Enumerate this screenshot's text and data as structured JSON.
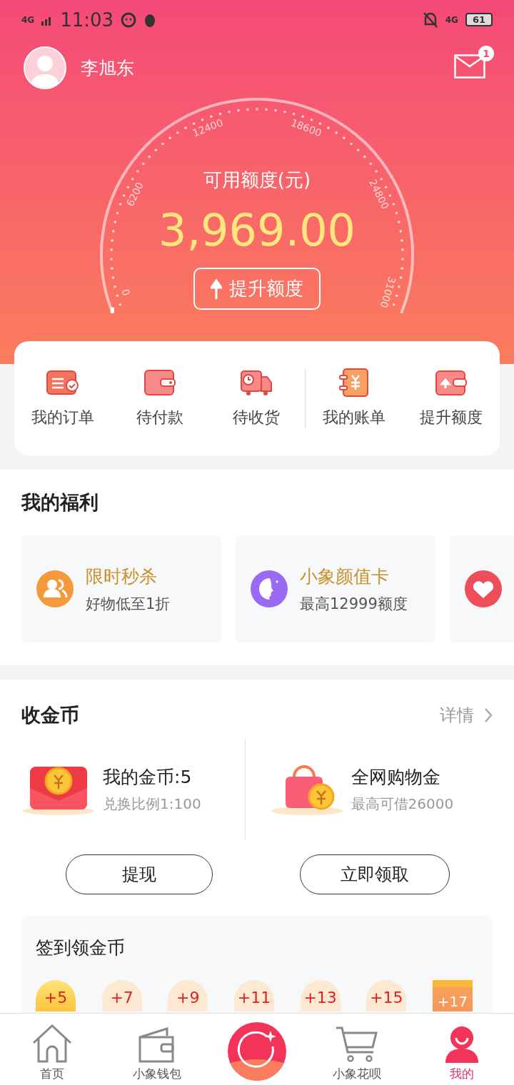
{
  "status_bar": {
    "network": "4G",
    "time": "11:03",
    "network_right": "4G",
    "battery": "61"
  },
  "header": {
    "user_name": "李旭东",
    "mail_badge": "1"
  },
  "gauge": {
    "label": "可用额度(元)",
    "amount": "3,969.00",
    "ticks": [
      "0",
      "6200",
      "12400",
      "18600",
      "24800",
      "31000"
    ],
    "button": "提升额度"
  },
  "quick_menu": {
    "groups": [
      [
        {
          "kind": "order",
          "label": "我的订单"
        },
        {
          "kind": "wallet",
          "label": "待付款"
        },
        {
          "kind": "truck",
          "label": "待收货"
        }
      ],
      [
        {
          "kind": "bill",
          "label": "我的账单"
        },
        {
          "kind": "raise",
          "label": "提升额度"
        }
      ]
    ]
  },
  "welfare": {
    "title": "我的福利",
    "cards": [
      {
        "kind": "people",
        "title": "限时秒杀",
        "subtitle": "好物低至1折"
      },
      {
        "kind": "face",
        "title": "小象颜值卡",
        "subtitle": "最高12999额度"
      },
      {
        "kind": "heart"
      }
    ]
  },
  "coins": {
    "title": "收金币",
    "link": "详情",
    "columns": [
      {
        "kind": "envelope",
        "title": "我的金币:5",
        "subtitle": "兑换比例1:100",
        "button": "提现"
      },
      {
        "kind": "bag",
        "title": "全网购物金",
        "subtitle": "最高可借26000",
        "button": "立即领取"
      }
    ]
  },
  "checkin": {
    "title": "签到领金币",
    "days": [
      {
        "kind": "coin",
        "label": "+5",
        "checked": true
      },
      {
        "kind": "coin",
        "label": "+7",
        "checked": false
      },
      {
        "kind": "coin",
        "label": "+9",
        "checked": false
      },
      {
        "kind": "coin",
        "label": "+11",
        "checked": false
      },
      {
        "kind": "coin",
        "label": "+13",
        "checked": false
      },
      {
        "kind": "coin",
        "label": "+15",
        "checked": false
      },
      {
        "kind": "gift",
        "label": "+17",
        "checked": false
      }
    ]
  },
  "tab_bar": [
    {
      "kind": "home",
      "label": "首页",
      "selected": false
    },
    {
      "kind": "wallet",
      "label": "小象钱包",
      "selected": false
    },
    {
      "kind": "center",
      "selected": false
    },
    {
      "kind": "cart",
      "label": "小象花呗",
      "selected": false
    },
    {
      "kind": "person",
      "label": "我的",
      "selected": true
    }
  ]
}
